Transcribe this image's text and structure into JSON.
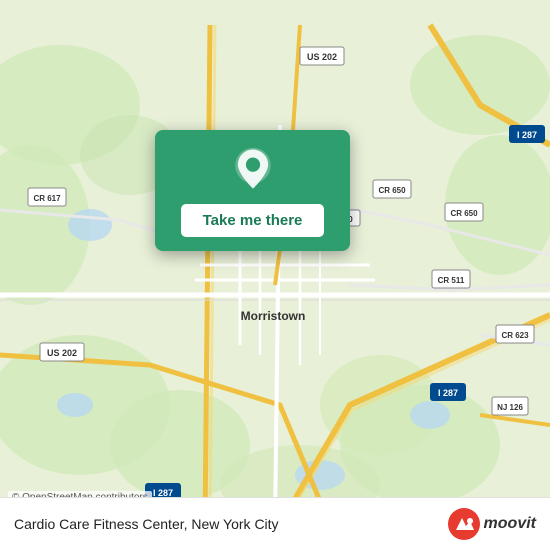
{
  "map": {
    "alt": "Map of Morristown, New York City area"
  },
  "card": {
    "button_label": "Take me there",
    "pin_icon": "location-pin"
  },
  "bottom_bar": {
    "location_name": "Cardio Care Fitness Center, New York City",
    "brand": "moovit"
  },
  "attribution": {
    "text": "© OpenStreetMap contributors"
  },
  "colors": {
    "card_bg": "#2e9e6e",
    "button_bg": "#ffffff",
    "button_text": "#1a7a55",
    "map_base": "#e8f0d8",
    "road_yellow": "#f5d76e",
    "road_white": "#ffffff",
    "water": "#b0d4f1",
    "moovit_red": "#e63b2e"
  }
}
